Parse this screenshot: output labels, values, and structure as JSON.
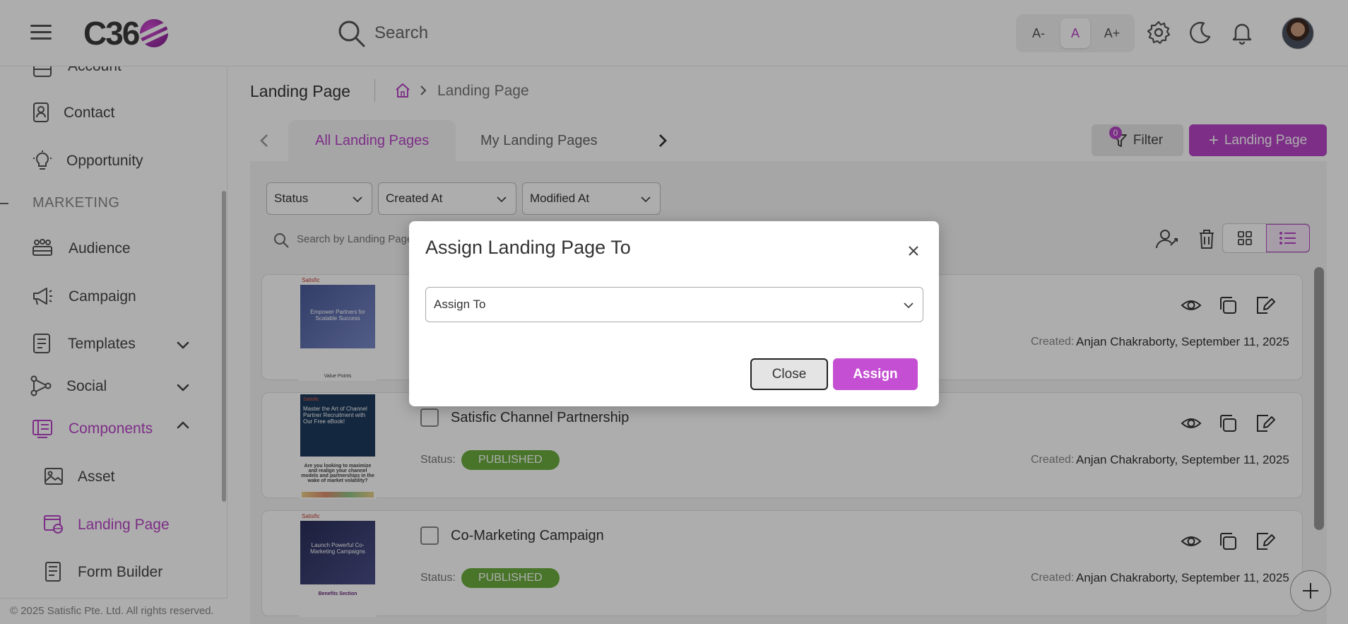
{
  "header": {
    "logo_text": "C36",
    "search_placeholder": "Search",
    "font_small": "A-",
    "font_normal": "A",
    "font_large": "A+"
  },
  "sidebar": {
    "items": [
      {
        "label": "Account"
      },
      {
        "label": "Contact"
      },
      {
        "label": "Opportunity"
      },
      {
        "label": "Audience"
      },
      {
        "label": "Campaign"
      },
      {
        "label": "Templates"
      },
      {
        "label": "Social"
      },
      {
        "label": "Components"
      },
      {
        "label": "Asset"
      },
      {
        "label": "Landing Page"
      },
      {
        "label": "Form Builder"
      }
    ],
    "section_marketing": "MARKETING",
    "footer": "© 2025 Satisfic Pte. Ltd. All rights reserved."
  },
  "main": {
    "page_title": "Landing Page",
    "breadcrumb_current": "Landing Page",
    "tabs": [
      {
        "label": "All Landing Pages"
      },
      {
        "label": "My Landing Pages"
      }
    ],
    "filter_label": "Filter",
    "filter_count": "0",
    "add_label": "Landing Page",
    "filters": {
      "status": "Status",
      "created_at": "Created At",
      "modified_at": "Modified At"
    },
    "list_search_placeholder": "Search by Landing Page",
    "cards": [
      {
        "title": "",
        "status_label": "Status:",
        "status": "",
        "created_label": "Created:",
        "created_value": "Anjan Chakraborty, September 11, 2025",
        "thumb_brand": "Satisfic",
        "thumb_heading": "Empower Partners for Scalable Success",
        "thumb_footer": "Value Points"
      },
      {
        "title": "Satisfic Channel Partnership",
        "status_label": "Status:",
        "status": "PUBLISHED",
        "created_label": "Created:",
        "created_value": "Anjan Chakraborty, September 11, 2025",
        "thumb_brand": "Satisfic",
        "thumb_heading": "Master the Art of Channel Partner Recruitment with Our Free eBook!",
        "thumb_footer": "Are you looking to maximize and realign your channel models and partnerships in the wake of market volatility?"
      },
      {
        "title": "Co-Marketing Campaign",
        "status_label": "Status:",
        "status": "PUBLISHED",
        "created_label": "Created:",
        "created_value": "Anjan Chakraborty, September 11, 2025",
        "thumb_brand": "Satisfic",
        "thumb_heading": "Launch Powerful Co-Marketing Campaigns",
        "thumb_footer": "Benefits Section"
      }
    ]
  },
  "modal": {
    "title": "Assign Landing Page To",
    "select_placeholder": "Assign To",
    "close_label": "Close",
    "assign_label": "Assign"
  },
  "colors": {
    "accent": "#b845c8",
    "published": "#6aad3d"
  }
}
